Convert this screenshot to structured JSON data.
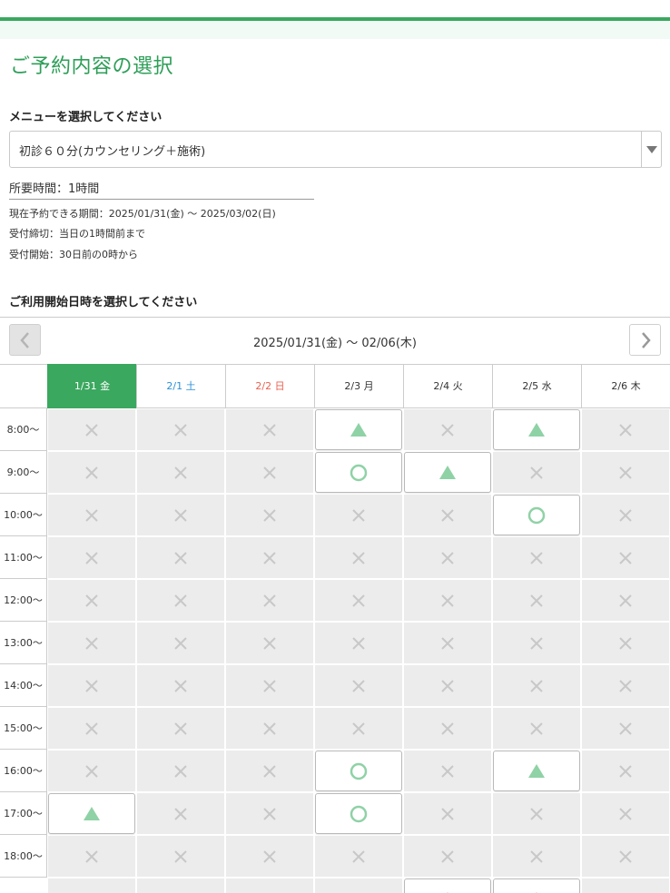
{
  "page": {
    "title": "ご予約内容の選択",
    "menu_label": "メニューを選択してください",
    "menu_selected": "初診６０分(カウンセリング＋施術)",
    "duration": "所要時間：1時間",
    "info_lines": [
      "現在予約できる期間：2025/01/31(金) 〜 2025/03/02(日)",
      "受付締切：当日の1時間前まで",
      "受付開始：30日前の0時から"
    ],
    "datetime_label": "ご利用開始日時を選択してください"
  },
  "calendar": {
    "range": "2025/01/31(金) 〜 02/06(木)",
    "days": [
      {
        "label": "1/31 金",
        "type": "today"
      },
      {
        "label": "2/1 土",
        "type": "sat"
      },
      {
        "label": "2/2 日",
        "type": "sun"
      },
      {
        "label": "2/3 月",
        "type": "wk"
      },
      {
        "label": "2/4 火",
        "type": "wk"
      },
      {
        "label": "2/5 水",
        "type": "wk"
      },
      {
        "label": "2/6 木",
        "type": "wk"
      }
    ],
    "times": [
      "8:00〜",
      "9:00〜",
      "10:00〜",
      "11:00〜",
      "12:00〜",
      "13:00〜",
      "14:00〜",
      "15:00〜",
      "16:00〜",
      "17:00〜",
      "18:00〜"
    ],
    "slots": [
      [
        "x",
        "x",
        "x",
        "triangle",
        "x",
        "triangle",
        "x"
      ],
      [
        "x",
        "x",
        "x",
        "circle",
        "triangle",
        "x",
        "x"
      ],
      [
        "x",
        "x",
        "x",
        "x",
        "x",
        "circle",
        "x"
      ],
      [
        "x",
        "x",
        "x",
        "x",
        "x",
        "x",
        "x"
      ],
      [
        "x",
        "x",
        "x",
        "x",
        "x",
        "x",
        "x"
      ],
      [
        "x",
        "x",
        "x",
        "x",
        "x",
        "x",
        "x"
      ],
      [
        "x",
        "x",
        "x",
        "x",
        "x",
        "x",
        "x"
      ],
      [
        "x",
        "x",
        "x",
        "x",
        "x",
        "x",
        "x"
      ],
      [
        "x",
        "x",
        "x",
        "circle",
        "x",
        "triangle",
        "x"
      ],
      [
        "triangle",
        "x",
        "x",
        "circle",
        "x",
        "x",
        "x"
      ],
      [
        "x",
        "x",
        "x",
        "x",
        "x",
        "x",
        "x"
      ],
      [
        "x",
        "x",
        "x",
        "x",
        "triangle",
        "triangle",
        "x"
      ]
    ],
    "icons": {
      "x": "cross-icon",
      "circle": "circle-icon",
      "triangle": "triangle-icon"
    },
    "colors": {
      "accent": "#3aa85f",
      "mark_green": "#8fd2a6",
      "cross": "#c8c8c8"
    }
  }
}
